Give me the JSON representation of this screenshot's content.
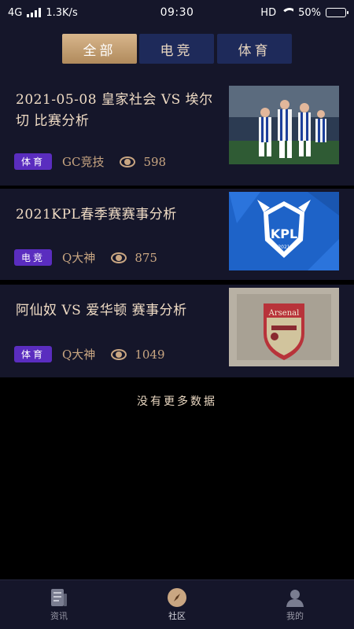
{
  "status_bar": {
    "network": "4G",
    "speed": "1.3K/s",
    "time": "09:30",
    "hd": "HD",
    "battery": "50%",
    "battery_level": 0.5
  },
  "tabs": [
    {
      "label": "全部",
      "active": true
    },
    {
      "label": "电竞",
      "active": false
    },
    {
      "label": "体育",
      "active": false
    }
  ],
  "articles": [
    {
      "title": "2021-05-08 皇家社会 VS 埃尔切 比赛分析",
      "category": "体育",
      "author": "GC竞技",
      "views": "598",
      "thumb": "football-players-photo"
    },
    {
      "title": "2021KPL春季赛赛事分析",
      "category": "电竞",
      "author": "Q大神",
      "views": "875",
      "thumb": "kpl-logo",
      "thumb_text": "KPL",
      "thumb_year": "2021"
    },
    {
      "title": "阿仙奴 VS 爱华顿 赛事分析",
      "category": "体育",
      "author": "Q大神",
      "views": "1049",
      "thumb": "arsenal-crest",
      "thumb_text": "Arsenal"
    }
  ],
  "footer_note": "没有更多数据",
  "bottom_nav": [
    {
      "label": "资讯",
      "icon": "news-icon",
      "active": false
    },
    {
      "label": "社区",
      "icon": "compass-icon",
      "active": true
    },
    {
      "label": "我的",
      "icon": "user-icon",
      "active": false
    }
  ],
  "colors": {
    "background": "#000000",
    "panel": "#15162a",
    "active_tab": "#c9a682",
    "inactive_tab": "#1e2a5a",
    "badge": "#5a2dbf",
    "text_gold": "#c9a682"
  }
}
